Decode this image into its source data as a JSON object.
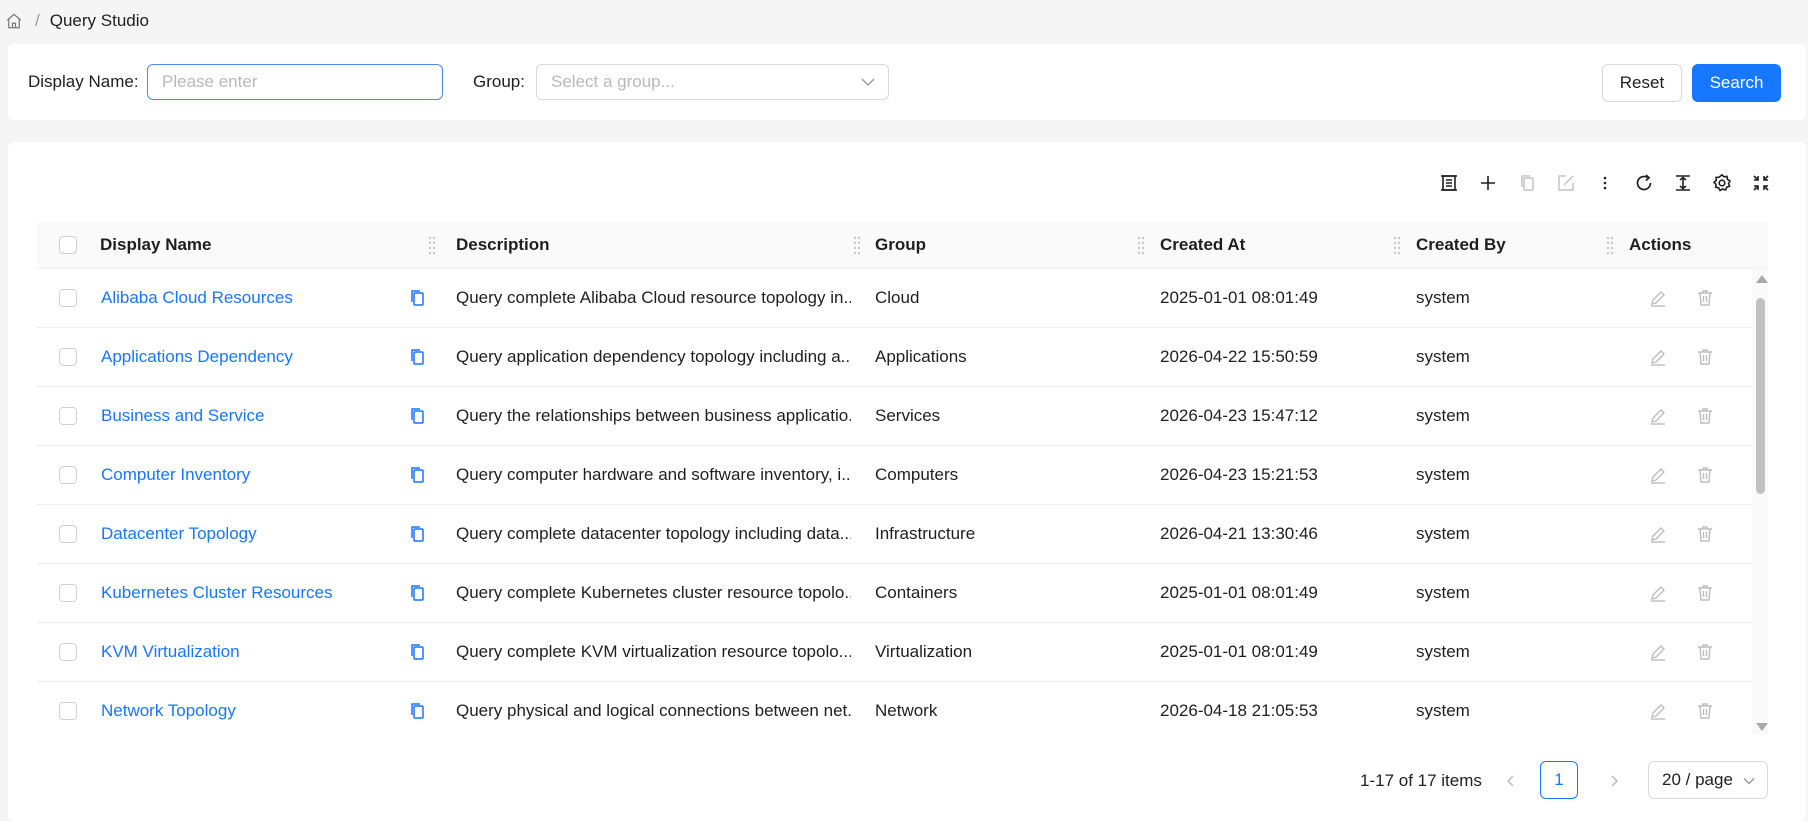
{
  "breadcrumb": {
    "separator": "/",
    "current": "Query Studio"
  },
  "filters": {
    "display_name_label": "Display Name",
    "display_name_placeholder": "Please enter",
    "group_label": "Group",
    "group_placeholder": "Select a group...",
    "reset_label": "Reset",
    "search_label": "Search"
  },
  "toolbar": {
    "icons": [
      "table-view-icon",
      "add-icon",
      "copy-icon",
      "edit-icon",
      "more-icon",
      "refresh-icon",
      "density-icon",
      "settings-icon",
      "fullscreen-icon"
    ]
  },
  "table": {
    "columns": [
      "Display Name",
      "Description",
      "Group",
      "Created At",
      "Created By",
      "Actions"
    ],
    "rows": [
      {
        "name": "Alibaba Cloud Resources",
        "description": "Query complete Alibaba Cloud resource topology in...",
        "group": "Cloud",
        "created_at": "2025-01-01 08:01:49",
        "created_by": "system"
      },
      {
        "name": "Applications Dependency",
        "description": "Query application dependency topology including a...",
        "group": "Applications",
        "created_at": "2026-04-22 15:50:59",
        "created_by": "system"
      },
      {
        "name": "Business and Service",
        "description": "Query the relationships between business applicatio...",
        "group": "Services",
        "created_at": "2026-04-23 15:47:12",
        "created_by": "system"
      },
      {
        "name": "Computer Inventory",
        "description": "Query computer hardware and software inventory, i...",
        "group": "Computers",
        "created_at": "2026-04-23 15:21:53",
        "created_by": "system"
      },
      {
        "name": "Datacenter Topology",
        "description": "Query complete datacenter topology including data...",
        "group": "Infrastructure",
        "created_at": "2026-04-21 13:30:46",
        "created_by": "system"
      },
      {
        "name": "Kubernetes Cluster Resources",
        "description": "Query complete Kubernetes cluster resource topolo...",
        "group": "Containers",
        "created_at": "2025-01-01 08:01:49",
        "created_by": "system"
      },
      {
        "name": "KVM Virtualization",
        "description": "Query complete KVM virtualization resource topolo...",
        "group": "Virtualization",
        "created_at": "2025-01-01 08:01:49",
        "created_by": "system"
      },
      {
        "name": "Network Topology",
        "description": "Query physical and logical connections between net...",
        "group": "Network",
        "created_at": "2026-04-18 21:05:53",
        "created_by": "system"
      }
    ]
  },
  "pagination": {
    "total_text": "1-17 of 17 items",
    "current_page": "1",
    "page_size": "20 / page"
  },
  "colors": {
    "primary": "#1677ff",
    "link": "#1677ff",
    "disabled": "#c4c4c4"
  }
}
